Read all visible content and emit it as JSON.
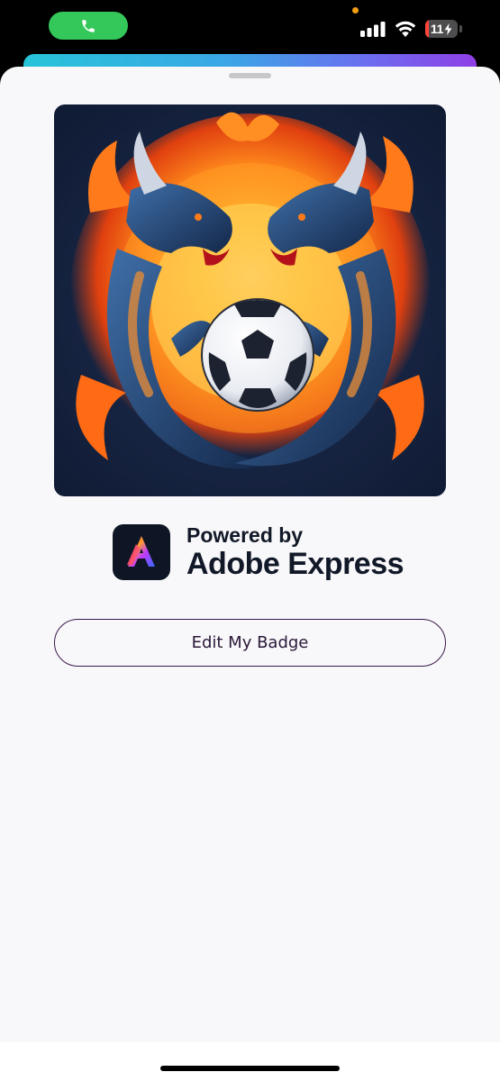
{
  "status_bar": {
    "battery_level": "11",
    "battery_percent": 11,
    "active_call": true,
    "icons": [
      "phone-icon",
      "cellular-signal-icon",
      "wifi-icon",
      "battery-charging-icon"
    ]
  },
  "sheet": {
    "image": {
      "description_icon": "dragons-soccer-badge-image"
    },
    "powered_by": {
      "line1": "Powered by",
      "line2": "Adobe Express",
      "logo_icon": "adobe-express-logo-icon"
    },
    "edit_button_label": "Edit My Badge"
  },
  "colors": {
    "call_green": "#34c759",
    "battery_red": "#ff453a",
    "sheet_bg": "#f8f7f9",
    "button_border": "#3a1b4a",
    "text_dark": "#111827"
  }
}
